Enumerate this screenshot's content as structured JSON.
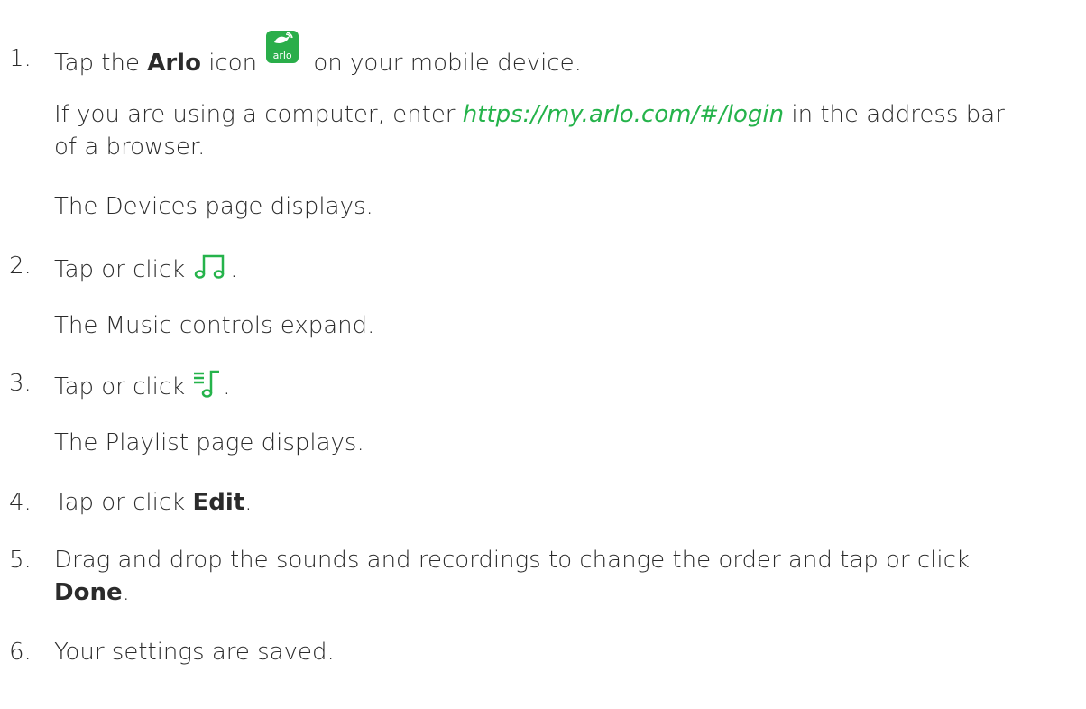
{
  "steps": [
    {
      "num": "1.",
      "pre": "Tap the ",
      "bold": "Arlo",
      "post_icon_text": " icon",
      "after": " on your mobile device."
    },
    {
      "num": "2.",
      "pre": "Tap or click",
      "after": "."
    },
    {
      "num": "3.",
      "pre": "Tap or click",
      "after": "."
    },
    {
      "num": "4.",
      "pre": "Tap or click ",
      "bold": "Edit",
      "after": "."
    },
    {
      "num": "5.",
      "line1": "Drag and drop the sounds and recordings to change the order and tap or click",
      "bold": "Done",
      "after": "."
    },
    {
      "num": "6.",
      "text": "Your settings are saved."
    }
  ],
  "notes": {
    "computer_pre": "If you are using a computer, enter ",
    "login_url": "https://my.arlo.com/#/login",
    "computer_post": " in the address bar",
    "computer_line2": "of a browser.",
    "devices": "The Devices page displays.",
    "music": "The Music controls expand.",
    "playlist": "The Playlist page displays."
  },
  "icons": {
    "arlo_app_icon": "arlo-app-icon",
    "arlo_brand_text": "arlo",
    "music_icon": "music-note-icon",
    "playlist_icon": "playlist-icon",
    "accent_color": "#25b34b"
  }
}
